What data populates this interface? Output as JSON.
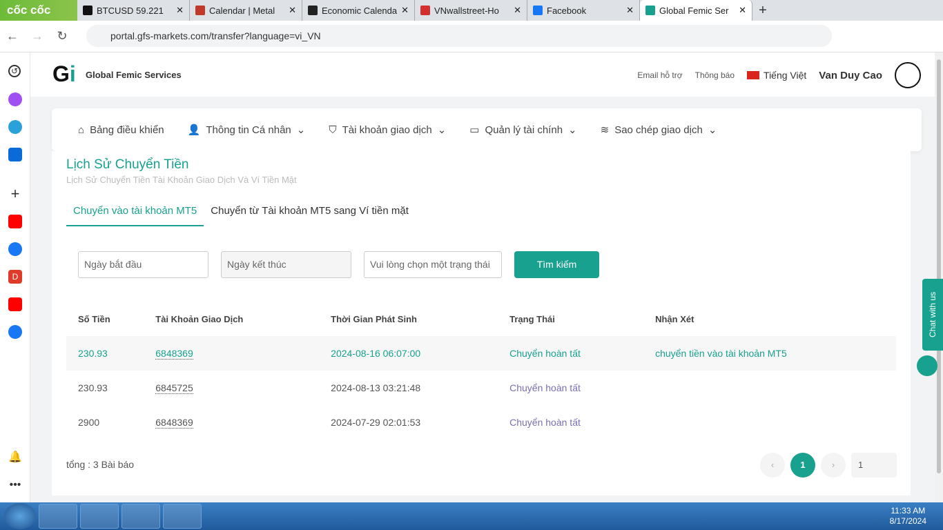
{
  "browser": {
    "brand": "cốc cốc",
    "tabs": [
      {
        "title": "BTCUSD 59.221",
        "color": "#111"
      },
      {
        "title": "Calendar | Metal",
        "color": "#c0392b"
      },
      {
        "title": "Economic Calendar",
        "color": "#222"
      },
      {
        "title": "VNwallstreet-Ho",
        "color": "#d32f2f"
      },
      {
        "title": "Facebook",
        "color": "#1877f2"
      },
      {
        "title": "Global Femic Ser",
        "color": "#17a18e"
      }
    ],
    "url": "portal.gfs-markets.com/transfer?language=vi_VN"
  },
  "header": {
    "brand_name": "Global Femic Services",
    "email_support": "Email hỗ trợ",
    "notifications": "Thông báo",
    "language": "Tiếng Việt",
    "user": "Van Duy Cao"
  },
  "menu": [
    "Bảng điều khiển",
    "Thông tin Cá nhân",
    "Tài khoản giao dịch",
    "Quản lý tài chính",
    "Sao chép giao dịch"
  ],
  "page": {
    "title": "Lịch Sử Chuyển Tiền",
    "subtitle": "Lịch Sử Chuyển Tiền Tài Khoản Giao Dịch Và Ví Tiền Mặt",
    "tabs": [
      "Chuyển vào tài khoản MT5",
      "Chuyển từ Tài khoản MT5 sang Ví tiền mặt"
    ],
    "filters": {
      "start_placeholder": "Ngày bắt đầu",
      "end_placeholder": "Ngày kết thúc",
      "status_placeholder": "Vui lòng chọn một trạng thái",
      "search": "Tìm kiếm"
    },
    "columns": [
      "Số Tiền",
      "Tài Khoản Giao Dịch",
      "Thời Gian Phát Sinh",
      "Trạng Thái",
      "Nhận Xét"
    ],
    "rows": [
      [
        "230.93",
        "6848369",
        "2024-08-16 06:07:00",
        "Chuyển hoàn tất",
        "chuyển tiền vào tài khoản MT5"
      ],
      [
        "230.93",
        "6845725",
        "2024-08-13 03:21:48",
        "Chuyển hoàn tất",
        ""
      ],
      [
        "2900",
        "6848369",
        "2024-07-29 02:01:53",
        "Chuyển hoàn tất",
        ""
      ]
    ],
    "total": "tổng : 3 Bài báo",
    "current_page": "1",
    "page_input": "1"
  },
  "chat": "Chat with us",
  "taskbar": {
    "time": "11:33 AM",
    "date": "8/17/2024"
  }
}
